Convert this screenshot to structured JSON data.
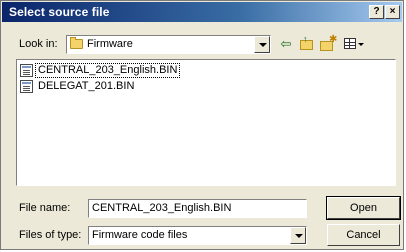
{
  "dialog": {
    "title": "Select source file",
    "help_button": "?",
    "close_button": "×"
  },
  "toolbar": {
    "look_in_label": "Look in:",
    "look_in_value": "Firmware"
  },
  "files": [
    {
      "name": "CENTRAL_203_English.BIN",
      "selected": true
    },
    {
      "name": "DELEGAT_201.BIN",
      "selected": false
    }
  ],
  "file_name": {
    "label": "File name:",
    "value": "CENTRAL_203_English.BIN"
  },
  "file_type": {
    "label": "Files of type:",
    "value": "Firmware code files"
  },
  "buttons": {
    "open": "Open",
    "cancel": "Cancel"
  },
  "icons": {
    "folder": "folder-icon",
    "back": "back-arrow-icon",
    "up": "up-folder-icon",
    "new_folder": "new-folder-icon",
    "views": "view-menu-icon",
    "file": "binary-file-icon"
  }
}
